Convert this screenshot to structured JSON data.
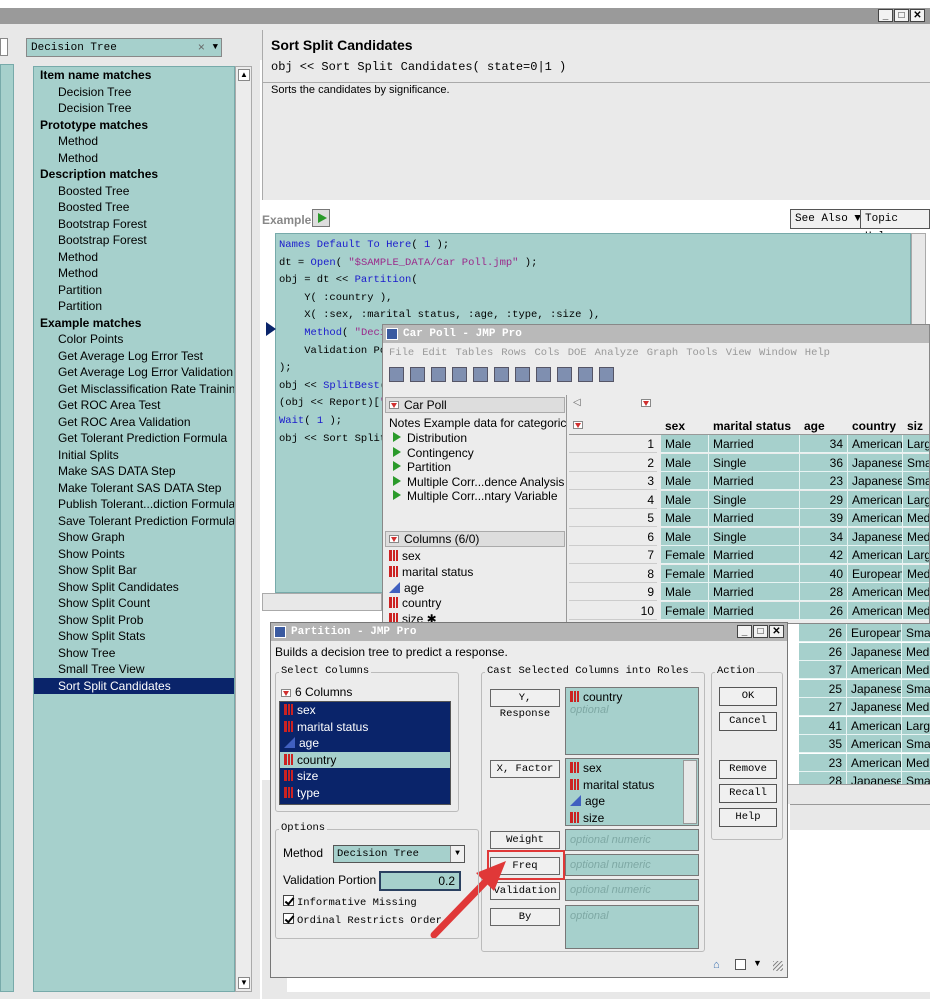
{
  "window": {
    "min": "_",
    "max": "□",
    "close": "✕"
  },
  "search": {
    "value": "Decision Tree",
    "clear": "×",
    "dropdown": "▼"
  },
  "index_list": [
    {
      "type": "header",
      "label": "Item name matches"
    },
    {
      "type": "item",
      "label": "Decision Tree"
    },
    {
      "type": "item",
      "label": "Decision Tree"
    },
    {
      "type": "header",
      "label": "Prototype matches"
    },
    {
      "type": "item",
      "label": "Method"
    },
    {
      "type": "item",
      "label": "Method"
    },
    {
      "type": "header",
      "label": "Description matches"
    },
    {
      "type": "item",
      "label": "Boosted Tree"
    },
    {
      "type": "item",
      "label": "Boosted Tree"
    },
    {
      "type": "item",
      "label": "Bootstrap Forest"
    },
    {
      "type": "item",
      "label": "Bootstrap Forest"
    },
    {
      "type": "item",
      "label": "Method"
    },
    {
      "type": "item",
      "label": "Method"
    },
    {
      "type": "item",
      "label": "Partition"
    },
    {
      "type": "item",
      "label": "Partition"
    },
    {
      "type": "header",
      "label": "Example matches"
    },
    {
      "type": "item",
      "label": "Color Points"
    },
    {
      "type": "item",
      "label": "Get Average Log Error Test"
    },
    {
      "type": "item",
      "label": "Get Average Log Error Validation"
    },
    {
      "type": "item",
      "label": "Get Misclassification Rate Training"
    },
    {
      "type": "item",
      "label": "Get ROC Area Test"
    },
    {
      "type": "item",
      "label": "Get ROC Area Validation"
    },
    {
      "type": "item",
      "label": "Get Tolerant Prediction Formula"
    },
    {
      "type": "item",
      "label": "Initial Splits"
    },
    {
      "type": "item",
      "label": "Make SAS DATA Step"
    },
    {
      "type": "item",
      "label": "Make Tolerant SAS DATA Step"
    },
    {
      "type": "item",
      "label": "Publish Tolerant...diction Formula"
    },
    {
      "type": "item",
      "label": "Save Tolerant Prediction Formula"
    },
    {
      "type": "item",
      "label": "Show Graph"
    },
    {
      "type": "item",
      "label": "Show Points"
    },
    {
      "type": "item",
      "label": "Show Split Bar"
    },
    {
      "type": "item",
      "label": "Show Split Candidates"
    },
    {
      "type": "item",
      "label": "Show Split Count"
    },
    {
      "type": "item",
      "label": "Show Split Prob"
    },
    {
      "type": "item",
      "label": "Show Split Stats"
    },
    {
      "type": "item",
      "label": "Show Tree"
    },
    {
      "type": "item",
      "label": "Small Tree View"
    },
    {
      "type": "selected",
      "label": "Sort Split Candidates"
    }
  ],
  "doc": {
    "title": "Sort Split Candidates",
    "signature": "obj << Sort Split Candidates( state=0|1 )",
    "description": "Sorts the candidates by significance.",
    "example_label": "Example",
    "see_also": "See Also ▼",
    "topic_help": "Topic Help"
  },
  "code_lines": [
    "Names Default To Here( 1 );",
    "dt = Open( \"$SAMPLE_DATA/Car Poll.jmp\" );",
    "obj = dt << Partition(",
    "    Y( :country ),",
    "    X( :sex, :marital status, :age, :type, :size ),",
    "    Method( \"Decis",
    "    Validation Por",
    ");",
    "obj << SplitBest(",
    "(obj << Report)[\"C",
    "Wait( 1 );",
    "obj << Sort Split"
  ],
  "car_poll": {
    "title": "Car Poll - JMP Pro",
    "menu": [
      "File",
      "Edit",
      "Tables",
      "Rows",
      "Cols",
      "DOE",
      "Analyze",
      "Graph",
      "Tools",
      "View",
      "Window",
      "Help"
    ],
    "table_name": "Car Poll",
    "notes": "Notes  Example data for categoric",
    "scripts": [
      "Distribution",
      "Contingency",
      "Partition",
      "Multiple Corr...dence Analysis",
      "Multiple Corr...ntary Variable"
    ],
    "columns_header": "Columns (6/0)",
    "columns": [
      {
        "name": "sex",
        "kind": "nominal"
      },
      {
        "name": "marital status",
        "kind": "nominal"
      },
      {
        "name": "age",
        "kind": "continuous"
      },
      {
        "name": "country",
        "kind": "nominal"
      },
      {
        "name": "size ✱",
        "kind": "nominal"
      }
    ],
    "grid_headers": [
      "sex",
      "marital status",
      "age",
      "country",
      "siz"
    ],
    "rows": [
      [
        "1",
        "Male",
        "Married",
        "34",
        "American",
        "Large"
      ],
      [
        "2",
        "Male",
        "Single",
        "36",
        "Japanese",
        "Small"
      ],
      [
        "3",
        "Male",
        "Married",
        "23",
        "Japanese",
        "Small"
      ],
      [
        "4",
        "Male",
        "Single",
        "29",
        "American",
        "Large"
      ],
      [
        "5",
        "Male",
        "Married",
        "39",
        "American",
        "Medi"
      ],
      [
        "6",
        "Male",
        "Single",
        "34",
        "Japanese",
        "Medi"
      ],
      [
        "7",
        "Female",
        "Married",
        "42",
        "American",
        "Large"
      ],
      [
        "8",
        "Female",
        "Married",
        "40",
        "European",
        "Medi"
      ],
      [
        "9",
        "Male",
        "Married",
        "28",
        "American",
        "Medi"
      ],
      [
        "10",
        "Female",
        "Married",
        "26",
        "American",
        "Medi"
      ]
    ],
    "extra_rows": [
      [
        "26",
        "European",
        "Smal"
      ],
      [
        "26",
        "Japanese",
        "Medi"
      ],
      [
        "37",
        "American",
        "Medi"
      ],
      [
        "25",
        "Japanese",
        "Smal"
      ],
      [
        "27",
        "Japanese",
        "Medi"
      ],
      [
        "41",
        "American",
        "Large"
      ],
      [
        "35",
        "American",
        "Smal"
      ],
      [
        "23",
        "American",
        "Medi"
      ],
      [
        "28",
        "Japanese",
        "Smal"
      ]
    ]
  },
  "partition": {
    "title": "Partition - JMP Pro",
    "subtitle": "Builds a decision tree to predict a response.",
    "select_columns_label": "Select Columns",
    "columns_count": "6 Columns",
    "columns": [
      {
        "name": "sex",
        "kind": "nominal",
        "selected": true
      },
      {
        "name": "marital status",
        "kind": "nominal",
        "selected": true
      },
      {
        "name": "age",
        "kind": "continuous",
        "selected": true
      },
      {
        "name": "country",
        "kind": "nominal",
        "selected": false
      },
      {
        "name": "size",
        "kind": "nominal",
        "selected": true
      },
      {
        "name": "type",
        "kind": "nominal",
        "selected": true
      }
    ],
    "cast_label": "Cast Selected Columns into Roles",
    "action_label": "Action",
    "roles": {
      "y_button": "Y, Response",
      "y_value": "country",
      "y_optional": "optional",
      "x_button": "X, Factor",
      "x_values": [
        "sex",
        "marital status",
        "age",
        "size"
      ],
      "weight_button": "Weight",
      "weight_placeholder": "optional numeric",
      "freq_button": "Freq",
      "freq_placeholder": "optional numeric",
      "validation_button": "Validation",
      "validation_placeholder": "optional numeric",
      "by_button": "By",
      "by_placeholder": "optional"
    },
    "actions": [
      "OK",
      "Cancel",
      "Remove",
      "Recall",
      "Help"
    ],
    "options_label": "Options",
    "method_label": "Method",
    "method_value": "Decision Tree",
    "validation_portion_label": "Validation Portion",
    "validation_portion_value": "0.2",
    "informative_missing": "Informative Missing",
    "ordinal_restricts": "Ordinal Restricts Order"
  },
  "colors": {
    "teal": "#a6d0cc",
    "selection": "#0a246a",
    "highlight": "#e03838"
  }
}
